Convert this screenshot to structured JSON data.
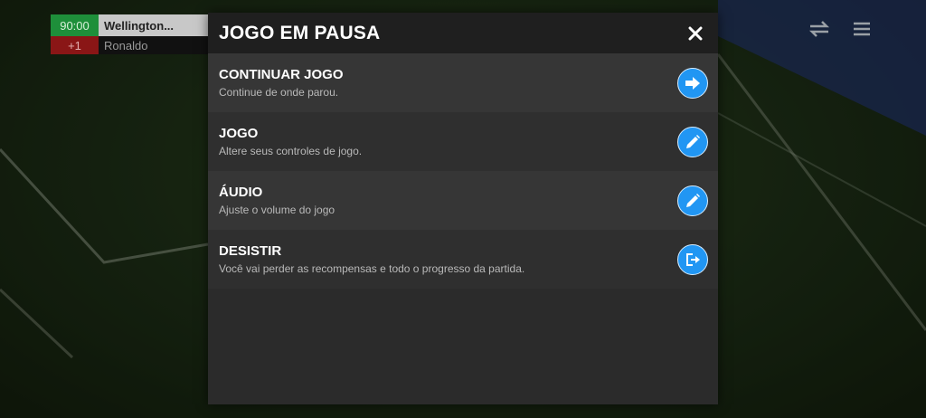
{
  "scoreboard": {
    "time": "90:00",
    "player1": "Wellington...",
    "extra": "+1",
    "player2": "Ronaldo"
  },
  "modal": {
    "title": "JOGO EM PAUSA",
    "close_icon": "close-icon",
    "items": [
      {
        "label": "CONTINUAR JOGO",
        "description": "Continue de onde parou.",
        "icon": "arrow-right-icon"
      },
      {
        "label": "JOGO",
        "description": "Altere seus controles de jogo.",
        "icon": "pencil-icon"
      },
      {
        "label": "ÁUDIO",
        "description": "Ajuste o volume do jogo",
        "icon": "pencil-icon"
      },
      {
        "label": "DESISTIR",
        "description": "Você vai perder as recompensas e todo o progresso da partida.",
        "icon": "exit-icon"
      }
    ]
  },
  "colors": {
    "accent": "#2196f3",
    "modal_bg": "#2b2b2b",
    "header_bg": "#1f1f1f"
  }
}
